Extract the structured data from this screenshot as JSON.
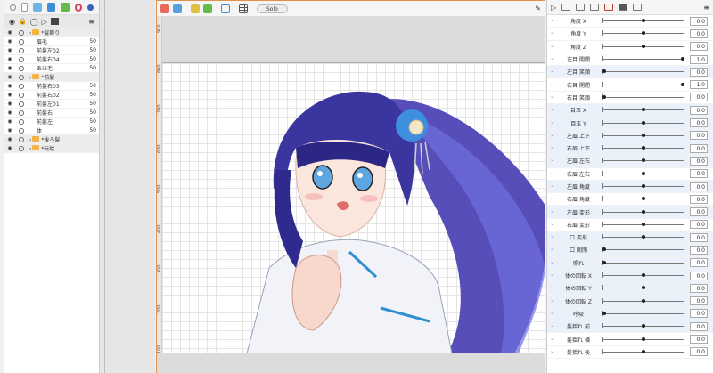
{
  "layers": {
    "items": [
      {
        "name": "*髪飾り",
        "opacity": "",
        "kind": "folder"
      },
      {
        "name": "眉毛",
        "opacity": "50",
        "kind": "item"
      },
      {
        "name": "前髪左02",
        "opacity": "50",
        "kind": "item"
      },
      {
        "name": "前髪右04",
        "opacity": "50",
        "kind": "item"
      },
      {
        "name": "あほ毛",
        "opacity": "50",
        "kind": "item"
      },
      {
        "name": "*前髪",
        "opacity": "",
        "kind": "folder"
      },
      {
        "name": "前髪右03",
        "opacity": "50",
        "kind": "item"
      },
      {
        "name": "前髪右02",
        "opacity": "50",
        "kind": "item"
      },
      {
        "name": "前髪左01",
        "opacity": "50",
        "kind": "item"
      },
      {
        "name": "前髪右",
        "opacity": "50",
        "kind": "item"
      },
      {
        "name": "前髪左",
        "opacity": "50",
        "kind": "item"
      },
      {
        "name": "体",
        "opacity": "50",
        "kind": "item"
      },
      {
        "name": "*後ろ髪",
        "opacity": "",
        "kind": "folder"
      },
      {
        "name": "*元絵",
        "opacity": "",
        "kind": "folder"
      }
    ]
  },
  "canvas": {
    "solo_label": "Solo",
    "ruler_ticks": [
      "900",
      "800",
      "700",
      "600",
      "500",
      "400",
      "300",
      "200",
      "100"
    ]
  },
  "params": {
    "items": [
      {
        "label": "角度 X",
        "value": "0.0",
        "pos": 0.5
      },
      {
        "label": "角度 Y",
        "value": "0.0",
        "pos": 0.5
      },
      {
        "label": "角度 Z",
        "value": "0.0",
        "pos": 0.5
      },
      {
        "label": "左目 開閉",
        "value": "1.0",
        "pos": 1.0
      },
      {
        "label": "左目 笑顔",
        "value": "0.0",
        "pos": 0.0
      },
      {
        "label": "右目 開閉",
        "value": "1.0",
        "pos": 1.0
      },
      {
        "label": "右目 笑顔",
        "value": "0.0",
        "pos": 0.0
      },
      {
        "label": "目玉 X",
        "value": "0.0",
        "pos": 0.5
      },
      {
        "label": "目玉 Y",
        "value": "0.0",
        "pos": 0.5
      },
      {
        "label": "左眉 上下",
        "value": "0.0",
        "pos": 0.5
      },
      {
        "label": "右眉 上下",
        "value": "0.0",
        "pos": 0.5
      },
      {
        "label": "左眉 左右",
        "value": "0.0",
        "pos": 0.5
      },
      {
        "label": "右眉 左右",
        "value": "0.0",
        "pos": 0.5
      },
      {
        "label": "左眉 角度",
        "value": "0.0",
        "pos": 0.5
      },
      {
        "label": "右眉 角度",
        "value": "0.0",
        "pos": 0.5
      },
      {
        "label": "左眉 変形",
        "value": "0.0",
        "pos": 0.5
      },
      {
        "label": "右眉 変形",
        "value": "0.0",
        "pos": 0.5
      },
      {
        "label": "口 変形",
        "value": "0.0",
        "pos": 0.5
      },
      {
        "label": "口 開閉",
        "value": "0.0",
        "pos": 0.0
      },
      {
        "label": "照れ",
        "value": "0.0",
        "pos": 0.0
      },
      {
        "label": "体の回転 X",
        "value": "0.0",
        "pos": 0.5
      },
      {
        "label": "体の回転 Y",
        "value": "0.0",
        "pos": 0.5
      },
      {
        "label": "体の回転 Z",
        "value": "0.0",
        "pos": 0.5
      },
      {
        "label": "呼吸",
        "value": "0.0",
        "pos": 0.0
      },
      {
        "label": "髪揺れ 前",
        "value": "0.0",
        "pos": 0.5
      },
      {
        "label": "髪揺れ 横",
        "value": "0.0",
        "pos": 0.5
      },
      {
        "label": "髪揺れ 後",
        "value": "0.0",
        "pos": 0.5
      }
    ]
  },
  "colors": {
    "accent": "#e2924a",
    "highlight": "#eaf1fa",
    "folder": "#f4b347"
  }
}
